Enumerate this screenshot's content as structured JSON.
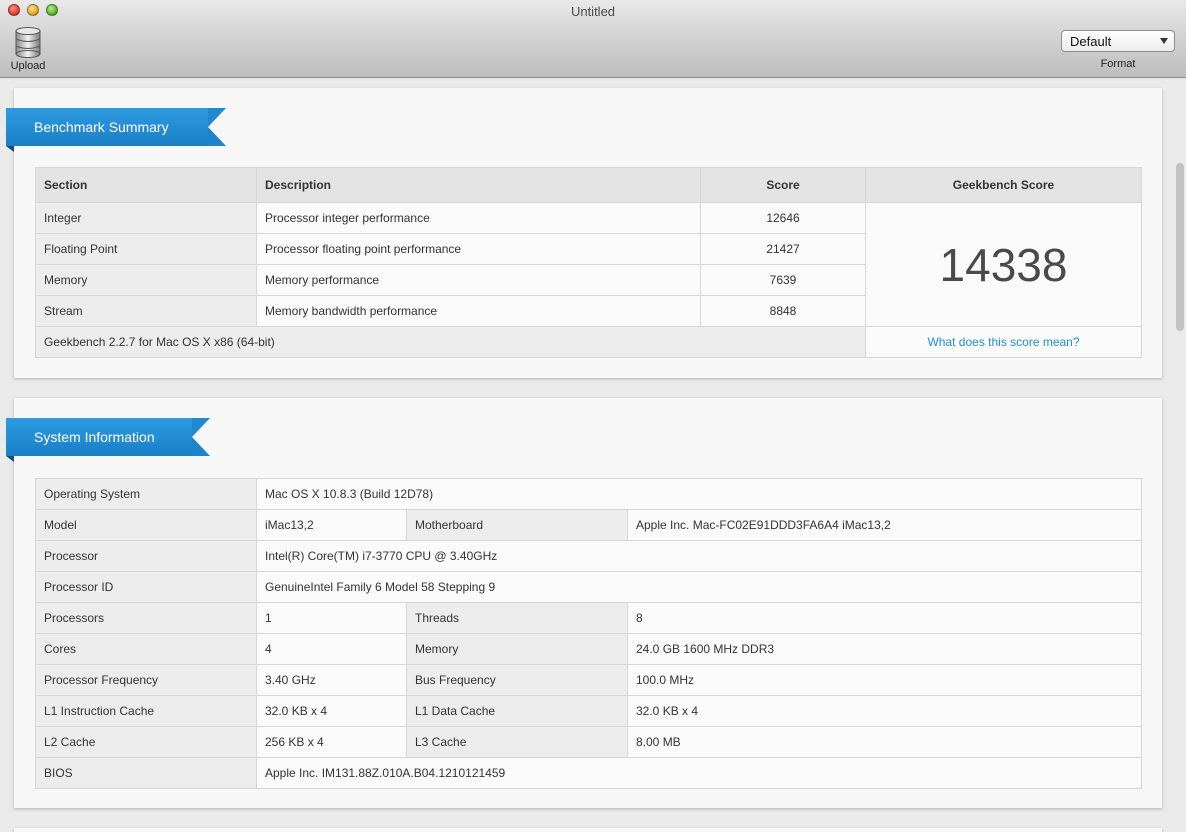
{
  "window": {
    "title": "Untitled"
  },
  "toolbar": {
    "upload_label": "Upload",
    "format_value": "Default",
    "format_label": "Format"
  },
  "benchmark": {
    "title": "Benchmark Summary",
    "headers": {
      "section": "Section",
      "description": "Description",
      "score": "Score",
      "geekbench": "Geekbench Score"
    },
    "rows": [
      {
        "section": "Integer",
        "description": "Processor integer performance",
        "score": "12646"
      },
      {
        "section": "Floating Point",
        "description": "Processor floating point performance",
        "score": "21427"
      },
      {
        "section": "Memory",
        "description": "Memory performance",
        "score": "7639"
      },
      {
        "section": "Stream",
        "description": "Memory bandwidth performance",
        "score": "8848"
      }
    ],
    "total_score": "14338",
    "version": "Geekbench 2.2.7 for Mac OS X x86 (64-bit)",
    "score_link": "What does this score mean?"
  },
  "system": {
    "title": "System Information",
    "os": {
      "label": "Operating System",
      "value": "Mac OS X 10.8.3 (Build 12D78)"
    },
    "model": {
      "label": "Model",
      "value": "iMac13,2"
    },
    "motherboard": {
      "label": "Motherboard",
      "value": "Apple Inc. Mac-FC02E91DDD3FA6A4 iMac13,2"
    },
    "processor": {
      "label": "Processor",
      "value": "Intel(R) Core(TM) i7-3770 CPU @ 3.40GHz"
    },
    "processor_id": {
      "label": "Processor ID",
      "value": "GenuineIntel Family 6 Model 58 Stepping 9"
    },
    "processors": {
      "label": "Processors",
      "value": "1"
    },
    "threads": {
      "label": "Threads",
      "value": "8"
    },
    "cores": {
      "label": "Cores",
      "value": "4"
    },
    "memory": {
      "label": "Memory",
      "value": "24.0 GB 1600 MHz DDR3"
    },
    "proc_freq": {
      "label": "Processor Frequency",
      "value": "3.40 GHz"
    },
    "bus_freq": {
      "label": "Bus Frequency",
      "value": "100.0 MHz"
    },
    "l1i": {
      "label": "L1 Instruction Cache",
      "value": "32.0 KB x 4"
    },
    "l1d": {
      "label": "L1 Data Cache",
      "value": "32.0 KB x 4"
    },
    "l2": {
      "label": "L2 Cache",
      "value": "256 KB x 4"
    },
    "l3": {
      "label": "L3 Cache",
      "value": "8.00 MB"
    },
    "bios": {
      "label": "BIOS",
      "value": "Apple Inc. IM131.88Z.010A.B04.1210121459"
    }
  }
}
